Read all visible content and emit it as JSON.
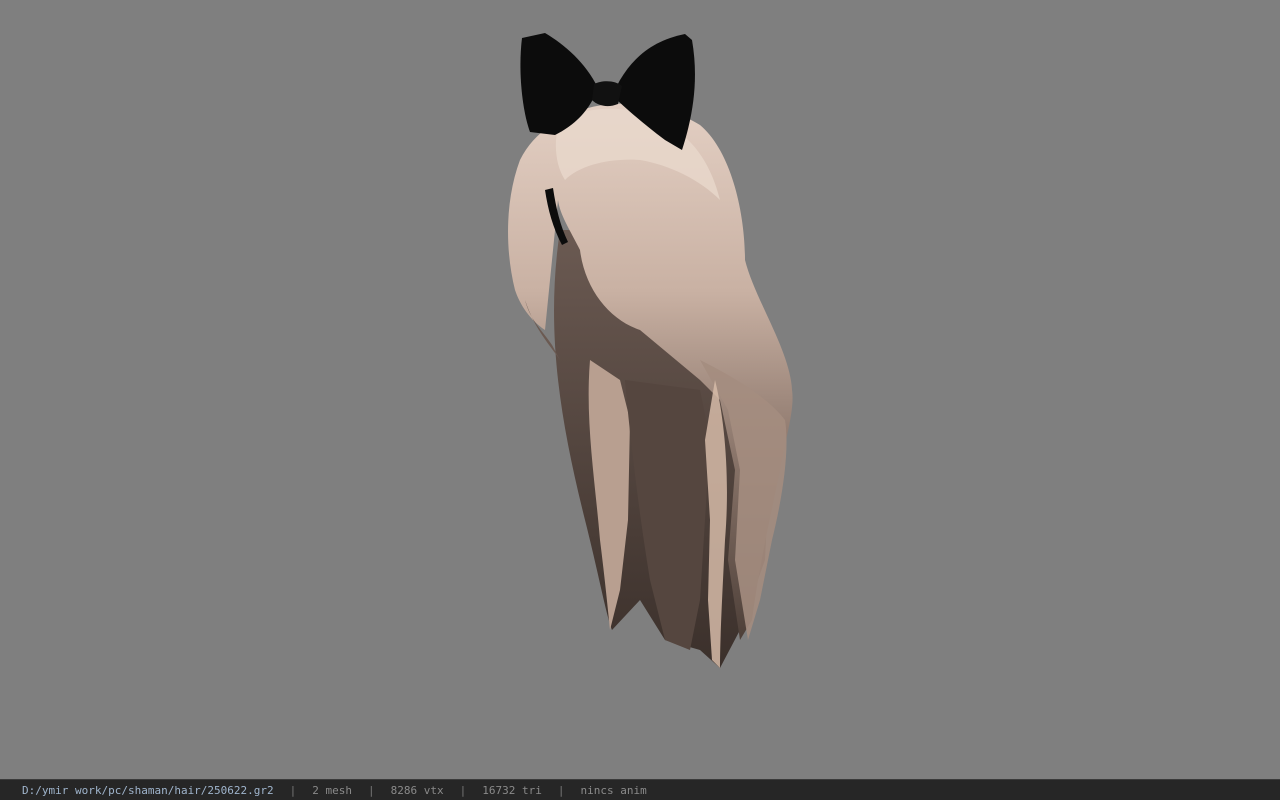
{
  "viewport": {
    "background_color": "#7f7f7f",
    "model_description_icon": "hair-model-icon"
  },
  "status": {
    "file_path": "D:/ymir work/pc/shaman/hair/250622.gr2",
    "separator": "|",
    "mesh": "2 mesh",
    "vertices": "8286 vtx",
    "triangles": "16732 tri",
    "animation": "nincs anim"
  },
  "colors": {
    "hair_light": "#d8c2b4",
    "hair_dark": "#4a3e38",
    "bow": "#0c0c0c",
    "statusbar_bg": "#262626"
  }
}
